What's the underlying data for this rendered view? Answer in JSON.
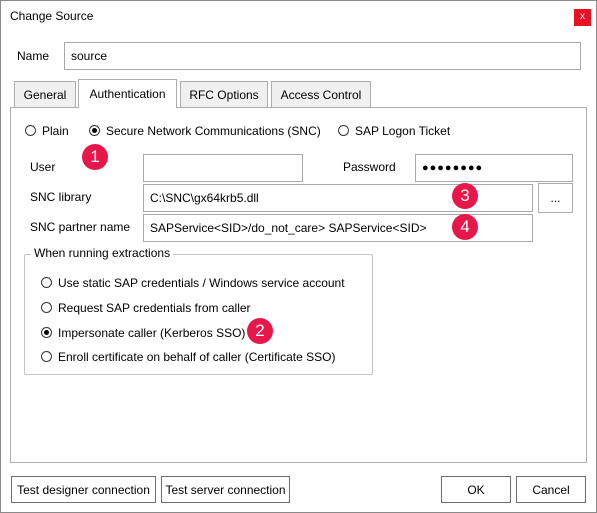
{
  "window": {
    "title": "Change Source",
    "close_label": "x"
  },
  "name_field": {
    "label": "Name",
    "value": "source"
  },
  "tabs": [
    {
      "label": "General"
    },
    {
      "label": "Authentication"
    },
    {
      "label": "RFC Options"
    },
    {
      "label": "Access Control"
    }
  ],
  "auth_mode": {
    "options": [
      {
        "label": "Plain",
        "selected": false
      },
      {
        "label": "Secure Network Communications (SNC)",
        "selected": true
      },
      {
        "label": "SAP Logon Ticket",
        "selected": false
      }
    ]
  },
  "user_field": {
    "label": "User",
    "value": ""
  },
  "password_field": {
    "label": "Password",
    "value": "●●●●●●●●"
  },
  "snc_library": {
    "label": "SNC library",
    "value": "C:\\SNC\\gx64krb5.dll",
    "browse_label": "..."
  },
  "snc_partner": {
    "label": "SNC partner name",
    "value": "SAPService<SID>/do_not_care> SAPService<SID>"
  },
  "extraction_group": {
    "title": "When running extractions",
    "options": [
      {
        "label": "Use static SAP credentials / Windows service account",
        "selected": false
      },
      {
        "label": "Request SAP credentials from caller",
        "selected": false
      },
      {
        "label": "Impersonate caller (Kerberos SSO)",
        "selected": true
      },
      {
        "label": "Enroll certificate on behalf of caller (Certificate SSO)",
        "selected": false
      }
    ]
  },
  "badges": [
    "1",
    "2",
    "3",
    "4"
  ],
  "footer": {
    "test_designer_label": "Test designer connection",
    "test_server_label": "Test server connection",
    "ok_label": "OK",
    "cancel_label": "Cancel"
  },
  "colors": {
    "badge": "#e8174a",
    "close_button": "#e81123"
  }
}
